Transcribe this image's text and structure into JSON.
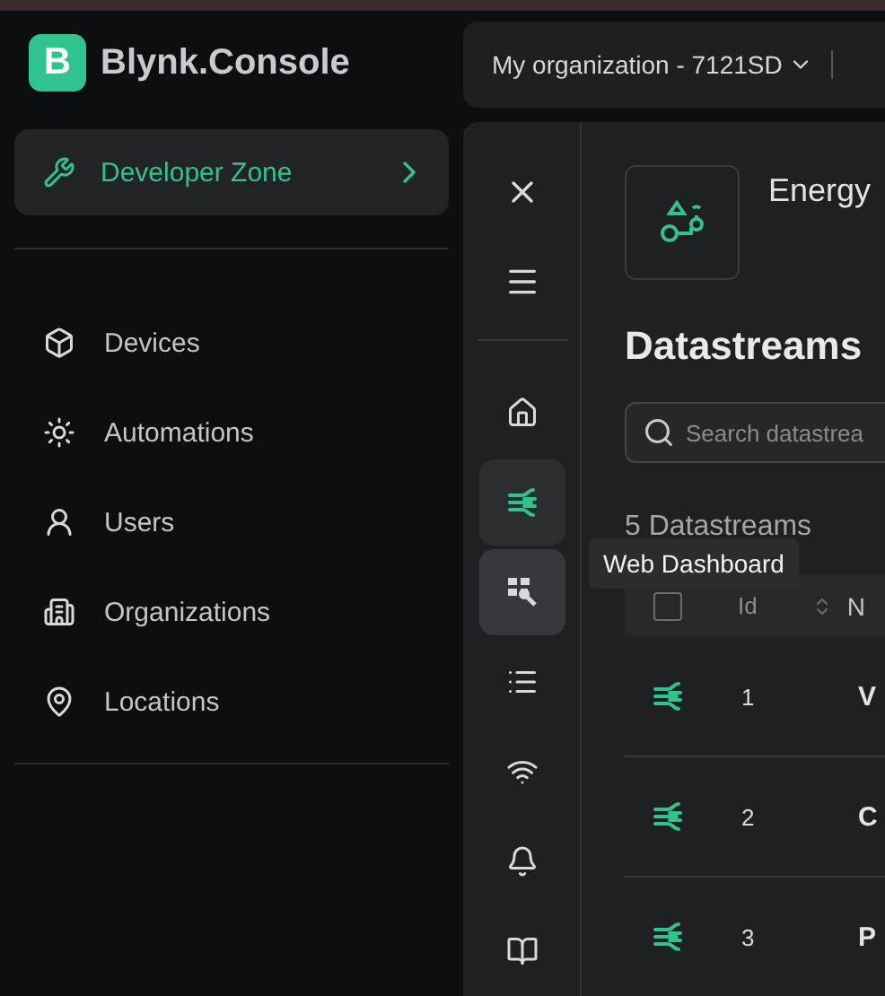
{
  "brand": {
    "logo_letter": "B",
    "name": "Blynk.Console"
  },
  "org_bar": {
    "organization": "My organization - 7121SD"
  },
  "developer_zone": {
    "label": "Developer Zone",
    "selected": true
  },
  "sidebar": {
    "items": [
      {
        "label": "Devices",
        "selected": false
      },
      {
        "label": "Automations",
        "selected": false
      },
      {
        "label": "Users",
        "selected": false
      },
      {
        "label": "Organizations",
        "selected": false
      },
      {
        "label": "Locations",
        "selected": false
      }
    ]
  },
  "rail": {
    "items": [
      {
        "selected": false,
        "hovered": false
      },
      {
        "selected": true,
        "hovered": false
      },
      {
        "selected": false,
        "hovered": true
      },
      {
        "selected": false,
        "hovered": false
      },
      {
        "selected": false,
        "hovered": false
      },
      {
        "selected": false,
        "hovered": false
      },
      {
        "selected": false,
        "hovered": false
      }
    ]
  },
  "tooltip": "Web Dashboard",
  "template": {
    "name": "Energy"
  },
  "page_title": "Datastreams",
  "search": {
    "placeholder": "Search datastrea"
  },
  "count": "5 Datastreams",
  "table": {
    "select_all_checked": false,
    "columns": [
      "Id",
      "N"
    ],
    "rows": [
      {
        "id": "1",
        "name": "V"
      },
      {
        "id": "2",
        "name": "C"
      },
      {
        "id": "3",
        "name": "P"
      }
    ]
  }
}
